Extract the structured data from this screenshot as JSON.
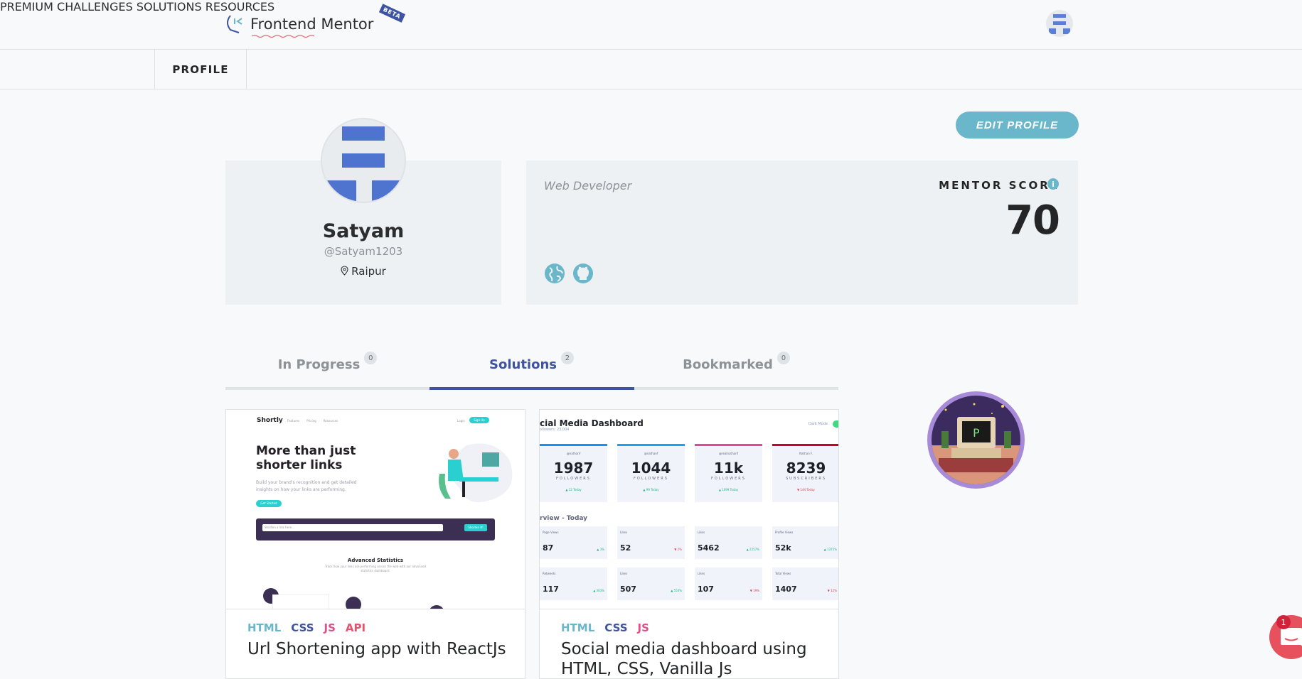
{
  "header": {
    "logo_text": "Frontend Mentor",
    "beta_label": "BETA",
    "nav": [
      "PREMIUM",
      "CHALLENGES",
      "SOLUTIONS",
      "RESOURCES"
    ]
  },
  "subnav": {
    "profile_tab": "PROFILE"
  },
  "profile": {
    "edit_label": "EDIT PROFILE",
    "name": "Satyam",
    "handle": "@Satyam1203",
    "location": "Raipur",
    "bio": "Web Developer",
    "score_label": "MENTOR SCORE",
    "score": "70"
  },
  "tabs": [
    {
      "label": "In Progress",
      "count": "0"
    },
    {
      "label": "Solutions",
      "count": "2"
    },
    {
      "label": "Bookmarked",
      "count": "0"
    }
  ],
  "solutions": [
    {
      "tags": [
        "HTML",
        "CSS",
        "JS",
        "API"
      ],
      "title": "Url Shortening app with ReactJs",
      "preview": {
        "brand": "Shortly",
        "links": [
          "Features",
          "Pricing",
          "Resources"
        ],
        "login": "Login",
        "signup": "Sign Up",
        "headline1": "More than just",
        "headline2": "shorter links",
        "sub1": "Build your brand's recognition and get detailed",
        "sub2": "insights on how your links are performing.",
        "cta": "Get Started",
        "input_placeholder": "Shorten a link here...",
        "shorten": "Shorten It!",
        "stats_title": "Advanced Statistics",
        "stats_sub1": "Track how your links are performing across the web with our advanced",
        "stats_sub2": "statistics dashboard."
      }
    },
    {
      "tags": [
        "HTML",
        "CSS",
        "JS"
      ],
      "title": "Social media dashboard using HTML, CSS, Vanilla Js",
      "preview": {
        "title": "cial Media Dashboard",
        "followers": "ollowers: 23,004",
        "dark_mode": "Dark Mode",
        "overview": "rview - Today",
        "cards": [
          {
            "handle": "@nathanf",
            "num": "1987",
            "unit": "FOLLOWERS",
            "delta": "▲ 12 Today",
            "color": "#198ff5",
            "up": true
          },
          {
            "handle": "@nathanf",
            "num": "1044",
            "unit": "FOLLOWERS",
            "delta": "▲ 99 Today",
            "color": "#1ca0f2",
            "up": true
          },
          {
            "handle": "@realnathanf",
            "num": "11k",
            "unit": "FOLLOWERS",
            "delta": "▲ 1099 Today",
            "color": "#df4996",
            "up": true
          },
          {
            "handle": "Nathan F.",
            "num": "8239",
            "unit": "SUBSCRIBERS",
            "delta": "▼ 144 Today",
            "color": "#c4032a",
            "up": false
          }
        ],
        "small": [
          {
            "label": "Page Views",
            "num": "87",
            "delta": "▲ 3%",
            "up": true
          },
          {
            "label": "Likes",
            "num": "52",
            "delta": "▼ 2%",
            "up": false
          },
          {
            "label": "Likes",
            "num": "5462",
            "delta": "▲ 2257%",
            "up": true
          },
          {
            "label": "Profile Views",
            "num": "52k",
            "delta": "▲ 1375%",
            "up": true
          },
          {
            "label": "Retweets",
            "num": "117",
            "delta": "▲ 303%",
            "up": true
          },
          {
            "label": "Likes",
            "num": "507",
            "delta": "▲ 553%",
            "up": true
          },
          {
            "label": "Likes",
            "num": "107",
            "delta": "▼ 19%",
            "up": false
          },
          {
            "label": "Total Views",
            "num": "1407",
            "delta": "▼ 12%",
            "up": false
          }
        ]
      }
    }
  ],
  "chat": {
    "count": "1"
  },
  "colors": {
    "accent": "#3e54a3",
    "teal": "#6ab6cb",
    "html": "#6ab6cb",
    "css": "#3e54a3",
    "js": "#e04f8a",
    "api": "#e3536b"
  }
}
